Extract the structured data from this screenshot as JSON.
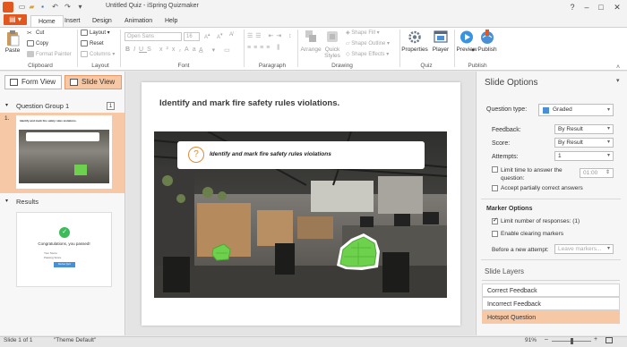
{
  "titlebar": {
    "title": "Untitled Quiz - iSpring Quizmaker",
    "quick_access": [
      "new-icon",
      "open-icon",
      "save-icon",
      "undo-icon",
      "redo-icon"
    ],
    "window_buttons": [
      "?",
      "–",
      "□",
      "✕"
    ]
  },
  "tabs": {
    "file_label": "▾",
    "items": [
      "Home",
      "Insert",
      "Design",
      "Animation",
      "Help"
    ],
    "active": "Home"
  },
  "ribbon": {
    "clipboard": {
      "paste": "Paste",
      "cut": "Cut",
      "copy": "Copy",
      "format_painter": "Format Painter",
      "label": "Clipboard"
    },
    "layout": {
      "layout": "Layout",
      "reset": "Reset",
      "columns": "Columns",
      "label": "Layout"
    },
    "font": {
      "family": "Open Sans",
      "size": "16",
      "label": "Font"
    },
    "paragraph": {
      "label": "Paragraph"
    },
    "drawing": {
      "arrange": "Arrange",
      "quick_styles": "Quick Styles",
      "shape_fill": "Shape Fill",
      "shape_outline": "Shape Outline",
      "shape_effects": "Shape Effects",
      "label": "Drawing"
    },
    "quiz": {
      "properties": "Properties",
      "player": "Player",
      "label": "Quiz"
    },
    "publish": {
      "preview": "Preview",
      "publish": "Publish",
      "label": "Publish"
    }
  },
  "left_panel": {
    "form_view": "Form View",
    "slide_view": "Slide View",
    "question_group": "Question Group 1",
    "question_count": "1",
    "slide_number": "1.",
    "thumb_question": "Identify and mark fire safety rules violations.",
    "results": "Results",
    "results_heading": "Congratulations, you passed!",
    "results_score_label": "Your Score",
    "results_passing_label": "Passing Score",
    "results_button": "Review Quiz"
  },
  "slide": {
    "question": "Identify and mark fire safety rules violations.",
    "banner_text": "Identify and mark fire safety rules violations",
    "question_icon": "?"
  },
  "right_panel": {
    "title": "Slide Options",
    "question_type_label": "Question type:",
    "question_type_value": "Graded",
    "feedback_label": "Feedback:",
    "feedback_value": "By Result",
    "score_label": "Score:",
    "score_value": "By Result",
    "attempts_label": "Attempts:",
    "attempts_value": "1",
    "limit_time_label": "Limit time to answer the question:",
    "limit_time_value": "01:00",
    "partial_label": "Accept partially correct answers",
    "marker_options": "Marker Options",
    "limit_responses_label": "Limit number of responses: (1)",
    "clearing_label": "Enable clearing markers",
    "before_attempt_label": "Before a new attempt:",
    "before_attempt_value": "Leave markers...",
    "slide_layers": "Slide Layers",
    "layers": [
      "Correct Feedback",
      "Incorrect Feedback",
      "Hotspot Question"
    ],
    "active_layer": "Hotspot Question"
  },
  "statusbar": {
    "slide": "Slide 1 of 1",
    "theme": "\"Theme Default\"",
    "zoom": "91%",
    "zoom_level": 0.5
  },
  "colors": {
    "accent": "#e2571e",
    "selection": "#f7c8a6",
    "marker_green": "#6ed14d"
  }
}
